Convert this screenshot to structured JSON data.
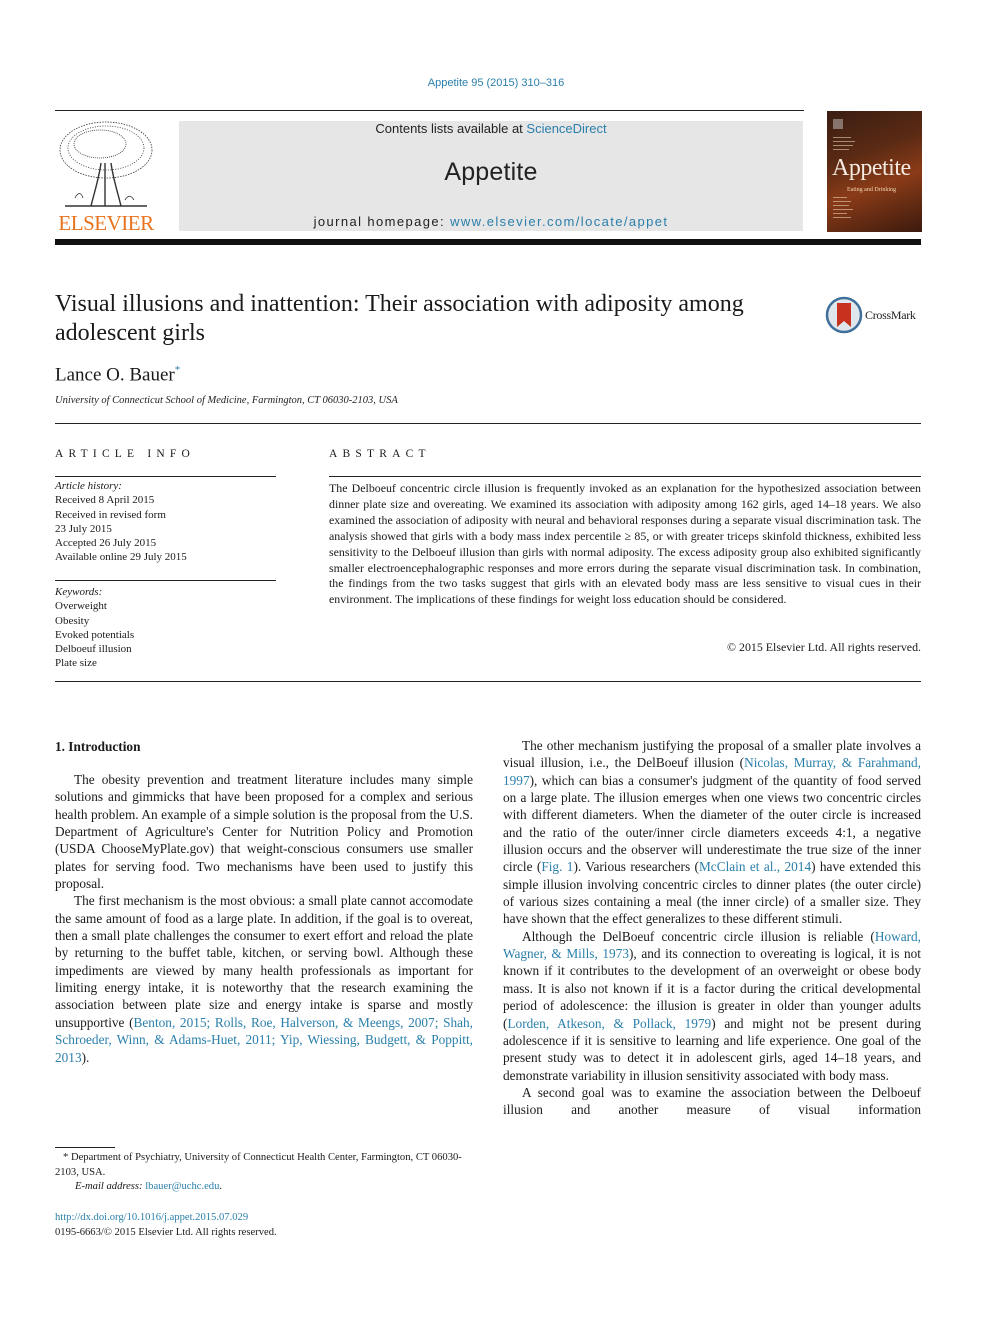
{
  "header": {
    "citation": "Appetite 95 (2015) 310–316",
    "contents_prefix": "Contents lists available at ",
    "contents_link": "ScienceDirect",
    "journal_name": "Appetite",
    "homepage_prefix": "journal homepage: ",
    "homepage_link": "www.elsevier.com/locate/appet",
    "publisher_logo_text": "ELSEVIER",
    "cover_title": "Appetite",
    "cover_subtitle": "Eating and Drinking",
    "crossmark_label": "CrossMark"
  },
  "article": {
    "title": "Visual illusions and inattention: Their association with adiposity among adolescent girls",
    "author": "Lance O. Bauer",
    "author_mark": "*",
    "affiliation": "University of Connecticut School of Medicine, Farmington, CT 06030-2103, USA"
  },
  "article_info": {
    "heading": "ARTICLE INFO",
    "history_label": "Article history:",
    "history": [
      "Received 8 April 2015",
      "Received in revised form",
      "23 July 2015",
      "Accepted 26 July 2015",
      "Available online 29 July 2015"
    ],
    "keywords_label": "Keywords:",
    "keywords": [
      "Overweight",
      "Obesity",
      "Evoked potentials",
      "Delboeuf illusion",
      "Plate size"
    ]
  },
  "abstract": {
    "heading": "ABSTRACT",
    "text": "The Delboeuf concentric circle illusion is frequently invoked as an explanation for the hypothesized association between dinner plate size and overeating. We examined its association with adiposity among 162 girls, aged 14–18 years. We also examined the association of adiposity with neural and behavioral responses during a separate visual discrimination task. The analysis showed that girls with a body mass index percentile ≥ 85, or with greater triceps skinfold thickness, exhibited less sensitivity to the Delboeuf illusion than girls with normal adiposity. The excess adiposity group also exhibited significantly smaller electroencephalographic responses and more errors during the separate visual discrimination task. In combination, the findings from the two tasks suggest that girls with an elevated body mass are less sensitive to visual cues in their environment. The implications of these findings for weight loss education should be considered.",
    "copyright": "© 2015 Elsevier Ltd. All rights reserved."
  },
  "body": {
    "section_title": "1.  Introduction",
    "p1": "The obesity prevention and treatment literature includes many simple solutions and gimmicks that have been proposed for a complex and serious health problem. An example of a simple solution is the proposal from the U.S. Department of Agriculture's Center for Nutrition Policy and Promotion (USDA ChooseMyPlate.gov) that weight-conscious consumers use smaller plates for serving food. Two mechanisms have been used to justify this proposal.",
    "p2_text": "The first mechanism is the most obvious: a small plate cannot accomodate the same amount of food as a large plate. In addition, if the goal is to overeat, then a small plate challenges the consumer to exert effort and reload the plate by returning to the buffet table, kitchen, or serving bowl. Although these impediments are viewed by many health professionals as important for limiting energy intake, it is noteworthy that the research examining the association between plate size and energy intake is sparse and mostly unsupportive (",
    "p2_refs": "Benton, 2015; Rolls, Roe, Halverson, & Meengs, 2007; Shah, Schroeder, Winn, & Adams-Huet, 2011; Yip, Wiessing, Budgett, & Poppitt, 2013",
    "p2_end": ").",
    "p3_a": "The other mechanism justifying the proposal of a smaller plate involves a visual illusion, i.e., the DelBoeuf illusion (",
    "p3_ref1": "Nicolas, Murray, & Farahmand, 1997",
    "p3_b": "), which can bias a consumer's judgment of the quantity of food served on a large plate. The illusion emerges when one views two concentric circles with different diameters. When the diameter of the outer circle is increased and the ratio of the outer/inner circle diameters exceeds 4:1, a negative illusion occurs and the observer will underestimate the true size of the inner circle (",
    "p3_ref2": "Fig. 1",
    "p3_c": "). Various researchers (",
    "p3_ref3": "McClain et al., 2014",
    "p3_d": ") have extended this simple illusion involving concentric circles to dinner plates (the outer circle) of various sizes containing a meal (the inner circle) of a smaller size. They have shown that the effect generalizes to these different stimuli.",
    "p4_a": "Although the DelBoeuf concentric circle illusion is reliable (",
    "p4_ref1": "Howard, Wagner, & Mills, 1973",
    "p4_b": "), and its connection to overeating is logical, it is not known if it contributes to the development of an overweight or obese body mass. It is also not known if it is a factor during the critical developmental period of adolescence: the illusion is greater in older than younger adults (",
    "p4_ref2": "Lorden, Atkeson, & Pollack, 1979",
    "p4_c": ") and might not be present during adolescence if it is sensitive to learning and life experience. One goal of the present study was to detect it in adolescent girls, aged 14–18 years, and demonstrate variability in illusion sensitivity associated with body mass.",
    "p5": "A second goal was to examine the association between the Delboeuf illusion and another measure of visual information"
  },
  "footnote": {
    "mark": "*",
    "text": " Department of Psychiatry, University of Connecticut Health Center, Farmington, CT 06030-2103, USA.",
    "email_label": "E-mail address: ",
    "email": "lbauer@uchc.edu",
    "email_end": ".",
    "doi": "http://dx.doi.org/10.1016/j.appet.2015.07.029",
    "issn_copyright": "0195-6663/© 2015 Elsevier Ltd. All rights reserved."
  },
  "colors": {
    "link": "#2a7fab",
    "elsevier_orange": "#e8731e",
    "banner_gray": "#e6e6e6"
  }
}
